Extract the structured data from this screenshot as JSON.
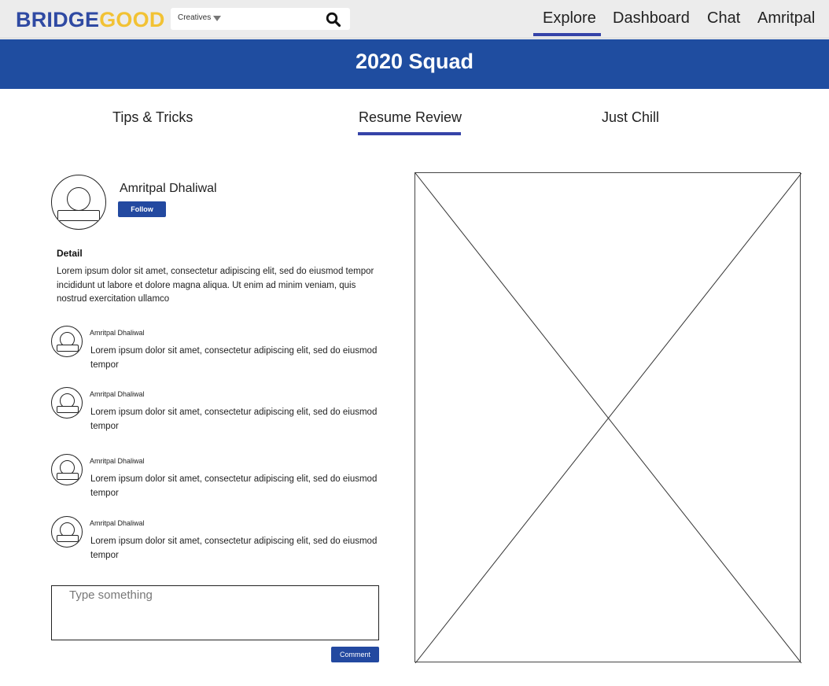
{
  "header": {
    "logo_part1": "BRIDGE",
    "logo_part2": "GOOD",
    "search": {
      "category": "Creatives",
      "placeholder": ""
    },
    "nav": [
      "Explore",
      "Dashboard",
      "Chat",
      "Amritpal"
    ],
    "active_nav": "Explore"
  },
  "banner": {
    "title": "2020 Squad"
  },
  "tabs": {
    "items": [
      "Tips & Tricks",
      "Resume Review",
      "Just Chill"
    ],
    "active": "Resume Review"
  },
  "post": {
    "author": "Amritpal Dhaliwal",
    "follow_label": "Follow",
    "detail_heading": "Detail",
    "detail_text": "Lorem ipsum dolor sit amet, consectetur adipiscing elit, sed do eiusmod tempor incididunt ut labore et dolore magna aliqua. Ut enim ad minim veniam, quis nostrud exercitation ullamco"
  },
  "comments": [
    {
      "name": "Amritpal Dhaliwal",
      "text": "Lorem ipsum dolor sit amet, consectetur adipiscing elit, sed do eiusmod tempor"
    },
    {
      "name": "Amritpal Dhaliwal",
      "text": "Lorem ipsum dolor sit amet, consectetur adipiscing elit, sed do eiusmod tempor"
    },
    {
      "name": "Amritpal Dhaliwal",
      "text": "Lorem ipsum dolor sit amet, consectetur adipiscing elit, sed do eiusmod tempor"
    },
    {
      "name": "Amritpal Dhaliwal",
      "text": "Lorem ipsum dolor sit amet, consectetur adipiscing elit, sed do eiusmod tempor"
    }
  ],
  "composer": {
    "placeholder": "Type something",
    "submit_label": "Comment"
  },
  "colors": {
    "brand_blue": "#2f4aa3",
    "brand_yellow": "#f2c234",
    "banner_blue": "#1f4da0",
    "accent_underline": "#3543a8",
    "button_blue": "#2349a0"
  },
  "icons": {
    "search": "search-icon",
    "dropdown": "chevron-down-icon",
    "avatar": "user-avatar-icon",
    "image": "image-placeholder-icon"
  }
}
